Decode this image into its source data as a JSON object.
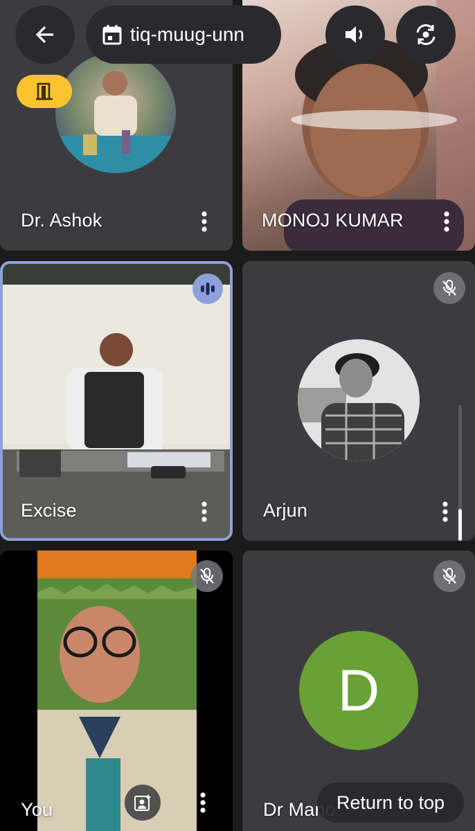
{
  "header": {
    "meeting_code": "tiq-muug-unn",
    "back_icon": "arrow-back-icon",
    "calendar_icon": "calendar-icon",
    "speaker_icon": "volume-icon",
    "switch_camera_icon": "camera-switch-icon"
  },
  "participants": [
    {
      "name": "Dr. Ashok",
      "has_room_badge": true
    },
    {
      "name": "MONOJ KUMAR"
    },
    {
      "name": "Excise",
      "speaking": true
    },
    {
      "name": "Arjun",
      "muted": true
    },
    {
      "name": "You",
      "muted": true
    },
    {
      "name": "Dr Mano",
      "avatar_letter": "D",
      "avatar_color": "#6aa136",
      "muted": true
    }
  ],
  "return_to_top": "Return to top",
  "colors": {
    "active_border": "#8ea0dc",
    "room_badge": "#fbc42d",
    "tile_bg": "#3c3c40"
  }
}
